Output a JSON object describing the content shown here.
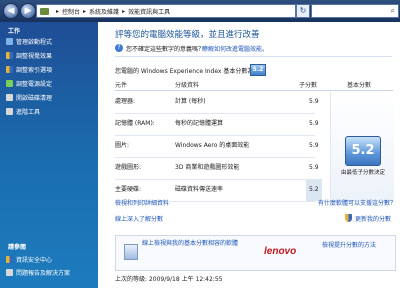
{
  "address": {
    "breadcrumbs": [
      "控制台",
      "系統及維護",
      "效能資訊與工具"
    ]
  },
  "sidebar": {
    "task_title": "工作",
    "items": [
      {
        "label": "管理啟動程式",
        "icon": "startup-manager-icon",
        "color": "#7fb1e8"
      },
      {
        "label": "調整視覺效果",
        "icon": "shield-icon",
        "color": "#e4b33b"
      },
      {
        "label": "調整索引選項",
        "icon": "shield-icon",
        "color": "#e4b33b"
      },
      {
        "label": "調整電源設定",
        "icon": "power-icon",
        "color": "#7ccc57"
      },
      {
        "label": "開啟磁碟清理",
        "icon": "disk-cleanup-icon",
        "color": "#d8d8d8"
      },
      {
        "label": "進階工具",
        "icon": "advanced-tools-icon",
        "color": "#d8d8d8"
      }
    ],
    "see_also_title": "請參閱",
    "see_also": [
      {
        "label": "資訊安全中心",
        "icon": "shield-icon",
        "color": "#e4b33b"
      },
      {
        "label": "問題報告及解決方案",
        "icon": "problem-reports-icon",
        "color": "#d8d8d8"
      }
    ]
  },
  "main": {
    "title": "評等您的電腦效能等級，並且進行改善",
    "question": "您不確定這些數字的意義嗎？",
    "question_link": "瞭解如何改進電腦效能。",
    "score_line": "您電腦的 Windows Experience Index 基本分數為",
    "score": "5.2",
    "table": {
      "headers": {
        "component": "元件",
        "rated": "分級資料",
        "subscore": "子分數",
        "basescore": "基本分數"
      },
      "rows": [
        {
          "component": "處理器:",
          "rated": "計算 (每秒)",
          "subscore": "5.9"
        },
        {
          "component": "記憶體 (RAM):",
          "rated": "每秒的記憶體運算",
          "subscore": "5.9"
        },
        {
          "component": "圖片:",
          "rated": "Windows Aero 的桌面效能",
          "subscore": "5.9"
        },
        {
          "component": "遊戲圖形:",
          "rated": "3D 商業和遊戲圖形效能",
          "subscore": "5.9"
        },
        {
          "component": "主要硬碟:",
          "rated": "磁碟資料傳送速率",
          "subscore": "5.2"
        }
      ],
      "base_score": "5.2",
      "base_caption": "由最低子分數決定"
    },
    "links": {
      "print": "檢視和列印詳細資料",
      "learn": "線上深入了解分數",
      "online_software": "有什麼軟體可以支援這分數？",
      "update": "更新我的分數"
    },
    "promo": {
      "link1": "線上檢視與我的基本分數相容的軟體",
      "brand": "lenovo",
      "link2": "檢視提升分數的方法"
    },
    "last_update": "上次的等級: 2009/9/18 上午 12:42:55"
  }
}
